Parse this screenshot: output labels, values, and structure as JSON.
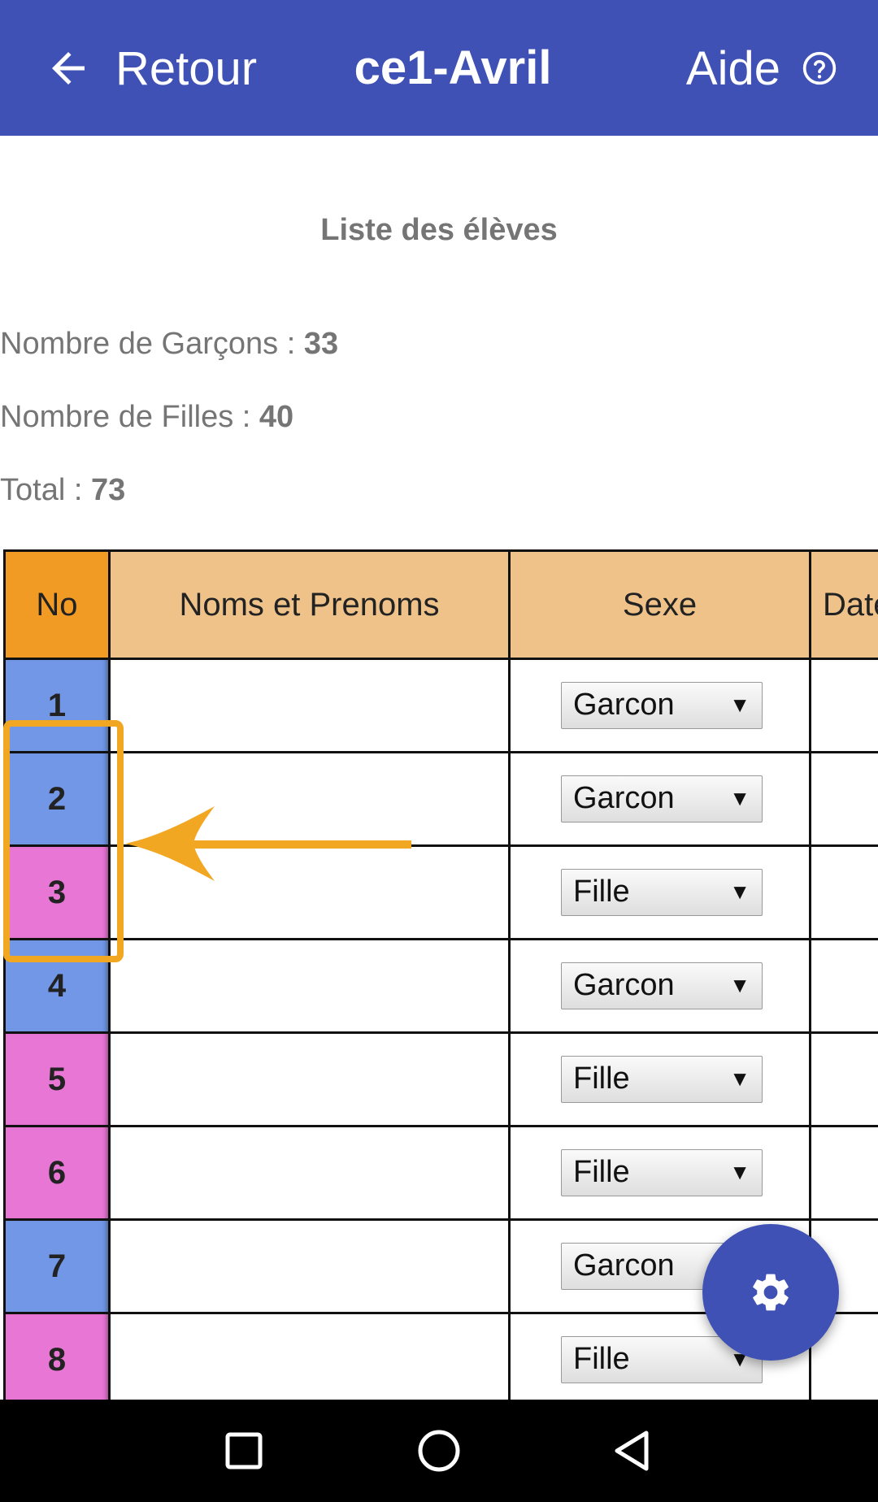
{
  "app_bar": {
    "back_label": "Retour",
    "title": "ce1-Avril",
    "help_label": "Aide",
    "background": "#3f51b5"
  },
  "summary": {
    "list_title": "Liste des élèves",
    "boys_label": "Nombre de Garçons : ",
    "boys_count": "33",
    "girls_label": "Nombre de Filles : ",
    "girls_count": "40",
    "total_label": "Total : ",
    "total_count": "73"
  },
  "table": {
    "headers": [
      "No",
      "Noms et Prenoms",
      "Sexe",
      "Date"
    ],
    "colors": {
      "no_header": "#f29b24",
      "header": "#efc28a",
      "garcon": "#7297e6",
      "fille": "#e876d4"
    },
    "rows": [
      {
        "no": "1",
        "name": "",
        "sexe": "Garcon"
      },
      {
        "no": "2",
        "name": "",
        "sexe": "Garcon"
      },
      {
        "no": "3",
        "name": "",
        "sexe": "Fille"
      },
      {
        "no": "4",
        "name": "",
        "sexe": "Garcon"
      },
      {
        "no": "5",
        "name": "",
        "sexe": "Fille"
      },
      {
        "no": "6",
        "name": "",
        "sexe": "Fille"
      },
      {
        "no": "7",
        "name": "",
        "sexe": "Garcon"
      },
      {
        "no": "8",
        "name": "",
        "sexe": "Fille"
      }
    ]
  },
  "annotation": {
    "color": "#f2a723",
    "highlight_rows": [
      "2",
      "3"
    ]
  },
  "fab": {
    "icon": "gear-icon"
  },
  "system_nav": {
    "icons": [
      "recents-square-icon",
      "home-circle-icon",
      "back-triangle-icon"
    ]
  }
}
